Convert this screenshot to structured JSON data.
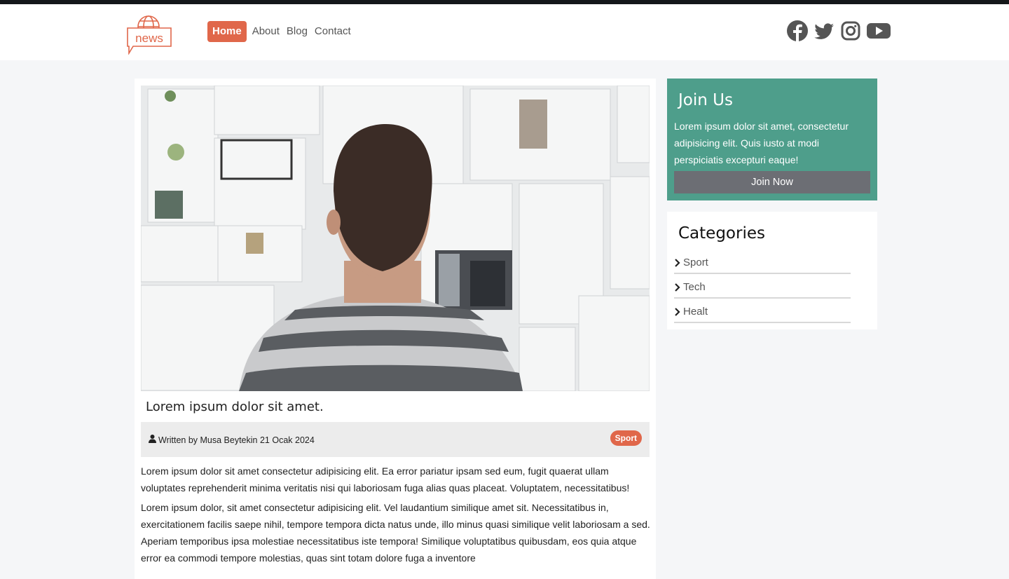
{
  "header": {
    "logo_text": "news",
    "nav": [
      {
        "label": "Home",
        "active": true
      },
      {
        "label": "About",
        "active": false
      },
      {
        "label": "Blog",
        "active": false
      },
      {
        "label": "Contact",
        "active": false
      }
    ],
    "social_icons": [
      "facebook-icon",
      "twitter-icon",
      "instagram-icon",
      "youtube-icon"
    ]
  },
  "article": {
    "image": "man-looking-at-wall-of-sketches",
    "title": "Lorem ipsum dolor sit amet.",
    "author_line": "Written by Musa Beytekin 21 Ocak 2024",
    "category_badge": "Sport",
    "paragraphs": [
      "Lorem ipsum dolor sit amet consectetur adipisicing elit. Ea error pariatur ipsam sed eum, fugit quaerat ullam voluptates reprehenderit minima veritatis nisi qui laboriosam fuga alias quas placeat. Voluptatem, necessitatibus!",
      "Lorem ipsum dolor, sit amet consectetur adipisicing elit. Vel laudantium similique amet sit. Necessitatibus in, exercitationem facilis saepe nihil, tempore tempora dicta natus unde, illo minus quasi similique velit laboriosam a sed. Aperiam temporibus ipsa molestiae necessitatibus iste tempora! Similique voluptatibus quibusdam, eos quia atque error ea commodi tempore molestias, quas sint totam dolore fuga a inventore"
    ]
  },
  "sidebar": {
    "join": {
      "title": "Join Us",
      "text": "Lorem ipsum dolor sit amet, consectetur adipisicing elit. Quis iusto at modi perspiciatis excepturi eaque!",
      "button": "Join Now"
    },
    "categories": {
      "title": "Categories",
      "items": [
        "Sport",
        "Tech",
        "Healt"
      ]
    }
  },
  "colors": {
    "accent": "#e0674a",
    "join_bg": "#4e9e8b",
    "join_button": "#6c6e74"
  }
}
